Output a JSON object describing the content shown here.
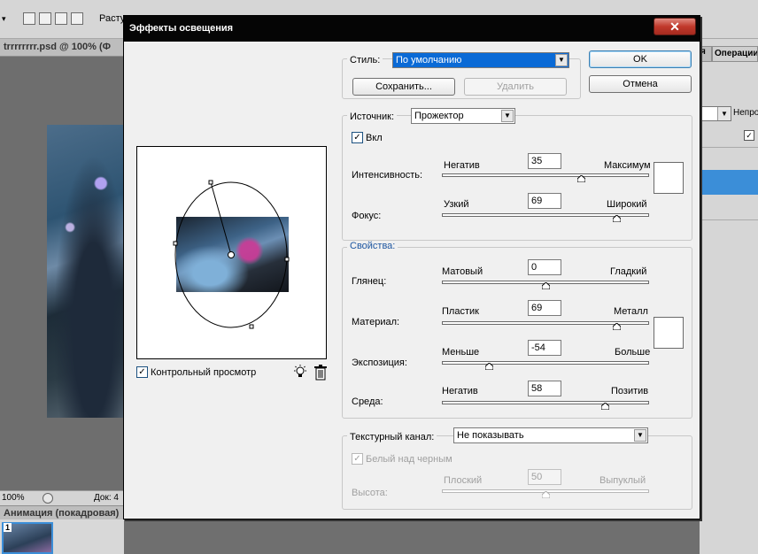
{
  "background": {
    "toolbar_label": "Расту",
    "document_tab": "trrrrrrrr.psd @ 100% (Ф",
    "zoom": "100%",
    "doc_label": "Док: 4",
    "animation_panel": "Анимация (покадровая)",
    "frame_number": "1",
    "right_panel_tab_1": "я",
    "right_panel_tab_2": "Операции",
    "right_panel_label": "Непро"
  },
  "dialog": {
    "title": "Эффекты освещения",
    "close_glyph": "✕",
    "preview_checkbox": {
      "label": "Контрольный просмотр",
      "checked": true
    },
    "style": {
      "label": "Стиль:",
      "value": "По умолчанию",
      "save_button": "Сохранить...",
      "delete_button": "Удалить"
    },
    "ok_button": "OK",
    "cancel_button": "Отмена",
    "source": {
      "label": "Источник:",
      "value": "Прожектор",
      "on_checkbox": {
        "label": "Вкл",
        "checked": true
      },
      "intensity": {
        "label": "Интенсивность:",
        "min_label": "Негатив",
        "max_label": "Максимум",
        "value": "35",
        "min": -100,
        "max": 100
      },
      "focus": {
        "label": "Фокус:",
        "min_label": "Узкий",
        "max_label": "Широкий",
        "value": "69",
        "min": -100,
        "max": 100
      }
    },
    "properties": {
      "label": "Свойства:",
      "gloss": {
        "label": "Глянец:",
        "min_label": "Матовый",
        "max_label": "Гладкий",
        "value": "0",
        "min": -100,
        "max": 100
      },
      "material": {
        "label": "Материал:",
        "min_label": "Пластик",
        "max_label": "Металл",
        "value": "69",
        "min": -100,
        "max": 100
      },
      "exposure": {
        "label": "Экспозиция:",
        "min_label": "Меньше",
        "max_label": "Больше",
        "value": "-54",
        "min": -100,
        "max": 100
      },
      "ambience": {
        "label": "Среда:",
        "min_label": "Негатив",
        "max_label": "Позитив",
        "value": "58",
        "min": -100,
        "max": 100
      }
    },
    "texture": {
      "label": "Текстурный канал:",
      "value": "Не показывать",
      "white_is_high": {
        "label": "Белый над черным",
        "checked": true,
        "disabled": true
      },
      "height": {
        "label": "Высота:",
        "min_label": "Плоский",
        "max_label": "Выпуклый",
        "value": "50",
        "min": 0,
        "max": 100,
        "disabled": true
      }
    }
  },
  "colors": {
    "titlebar": "#050505",
    "selection": "#0a6ad6",
    "close_button": "#c0392b",
    "swatch_color": "#ffffff",
    "panel_highlight": "#3b8ed8"
  },
  "icons": {
    "combo_arrow": "▼",
    "check": "✓",
    "light_bulb": "light-bulb-icon",
    "trash": "trash-icon"
  }
}
